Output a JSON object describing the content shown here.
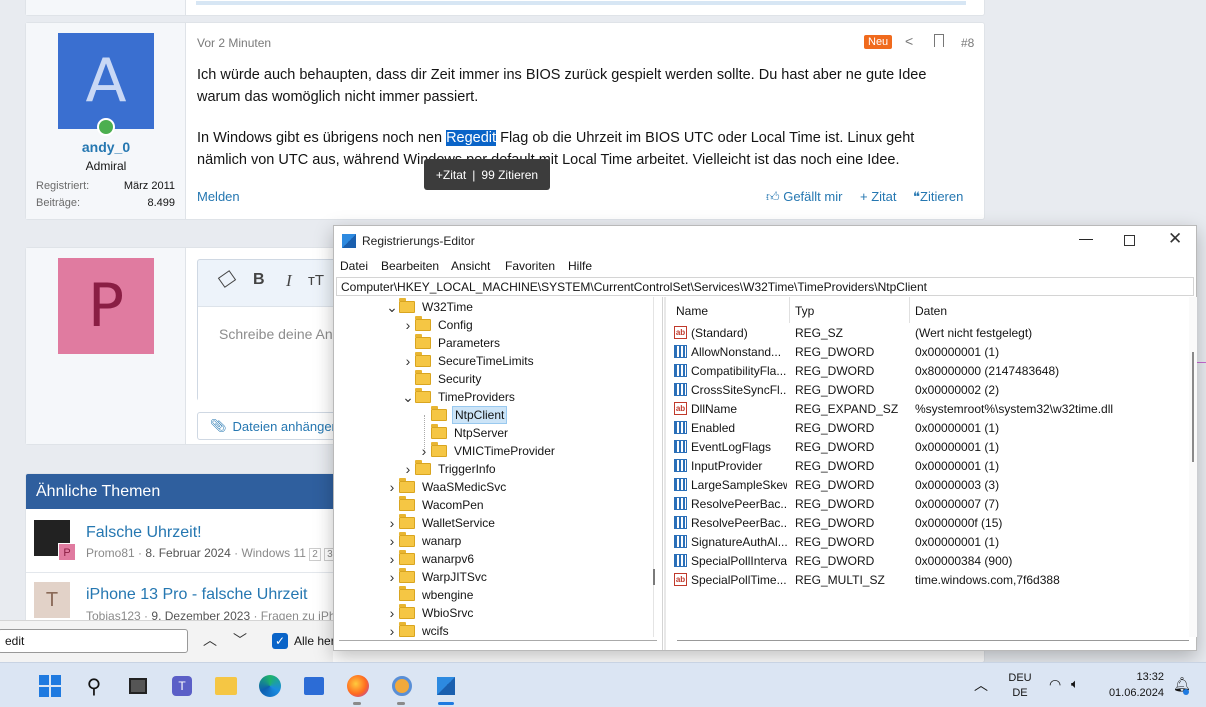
{
  "post": {
    "time": "Vor 2 Minuten",
    "new_badge": "Neu",
    "number": "#8",
    "author": {
      "avatar_letter": "A",
      "name": "andy_0",
      "role": "Admiral",
      "registered_label": "Registriert:",
      "registered_value": "März 2011",
      "posts_label": "Beiträge:",
      "posts_value": "8.499"
    },
    "para1": "Ich würde auch behaupten, dass dir Zeit immer ins BIOS zurück gespielt werden sollte. Du hast aber ne gute Idee warum das womöglich nicht immer passiert.",
    "para2_before": "In Windows gibt es übrigens noch nen ",
    "para2_highlight": "Regedit",
    "para2_after": " Flag ob die Uhrzeit im BIOS UTC oder Local Time ist. Linux geht nämlich von UTC aus, während Windows per default mit Local Time arbeitet. Vielleicht ist das noch eine Idee.",
    "tooltip_quote": "+Zitat",
    "tooltip_sep": "|",
    "tooltip_cite": "99 Zitieren",
    "report": "Melden",
    "like": "Gefällt mir",
    "quote": "+ Zitat",
    "cite": "Zitieren"
  },
  "reply": {
    "avatar_letter": "P",
    "placeholder": "Schreibe deine An",
    "attach": "Dateien anhängen",
    "toolbar": {
      "bold": "B",
      "italic": "I",
      "size": "тT"
    }
  },
  "similar": {
    "title": "Ähnliche Themen",
    "items": [
      {
        "title": "Falsche Uhrzeit!",
        "meta_user": "Promo81",
        "meta_date": "8. Februar 2024",
        "meta_forum": "Windows 11",
        "pages": [
          "2",
          "3"
        ],
        "badge": "P"
      },
      {
        "title": "iPhone 13 Pro - falsche Uhrzeit",
        "meta_user": "Tobias123",
        "meta_date": "9. Dezember 2023",
        "meta_forum": "Fragen zu iPhon",
        "avatar_letter": "T"
      }
    ]
  },
  "findbar": {
    "value": "edit",
    "checkbox_label": "Alle her"
  },
  "regedit": {
    "title": "Registrierungs-Editor",
    "menu": [
      "Datei",
      "Bearbeiten",
      "Ansicht",
      "Favoriten",
      "Hilfe"
    ],
    "address": "Computer\\HKEY_LOCAL_MACHINE\\SYSTEM\\CurrentControlSet\\Services\\W32Time\\TimeProviders\\NtpClient",
    "tree": [
      {
        "label": "W32Time",
        "level": 0,
        "exp": "v"
      },
      {
        "label": "Config",
        "level": 1,
        "exp": ">"
      },
      {
        "label": "Parameters",
        "level": 1,
        "exp": ""
      },
      {
        "label": "SecureTimeLimits",
        "level": 1,
        "exp": ">"
      },
      {
        "label": "Security",
        "level": 1,
        "exp": ""
      },
      {
        "label": "TimeProviders",
        "level": 1,
        "exp": "v"
      },
      {
        "label": "NtpClient",
        "level": 2,
        "exp": "",
        "selected": true
      },
      {
        "label": "NtpServer",
        "level": 2,
        "exp": ""
      },
      {
        "label": "VMICTimeProvider",
        "level": 2,
        "exp": ">"
      },
      {
        "label": "TriggerInfo",
        "level": 1,
        "exp": ">"
      },
      {
        "label": "WaaSMedicSvc",
        "level": 0,
        "exp": ">"
      },
      {
        "label": "WacomPen",
        "level": 0,
        "exp": ""
      },
      {
        "label": "WalletService",
        "level": 0,
        "exp": ">"
      },
      {
        "label": "wanarp",
        "level": 0,
        "exp": ">"
      },
      {
        "label": "wanarpv6",
        "level": 0,
        "exp": ">"
      },
      {
        "label": "WarpJITSvc",
        "level": 0,
        "exp": ">"
      },
      {
        "label": "wbengine",
        "level": 0,
        "exp": ""
      },
      {
        "label": "WbioSrvc",
        "level": 0,
        "exp": ">"
      },
      {
        "label": "wcifs",
        "level": 0,
        "exp": ">"
      }
    ],
    "columns": [
      "Name",
      "Typ",
      "Daten"
    ],
    "values": [
      {
        "name": "(Standard)",
        "type": "REG_SZ",
        "data": "(Wert nicht festgelegt)",
        "icon": "ab"
      },
      {
        "name": "AllowNonstand...",
        "type": "REG_DWORD",
        "data": "0x00000001 (1)",
        "icon": "bin"
      },
      {
        "name": "CompatibilityFla...",
        "type": "REG_DWORD",
        "data": "0x80000000 (2147483648)",
        "icon": "bin"
      },
      {
        "name": "CrossSiteSyncFl...",
        "type": "REG_DWORD",
        "data": "0x00000002 (2)",
        "icon": "bin"
      },
      {
        "name": "DllName",
        "type": "REG_EXPAND_SZ",
        "data": "%systemroot%\\system32\\w32time.dll",
        "icon": "ab"
      },
      {
        "name": "Enabled",
        "type": "REG_DWORD",
        "data": "0x00000001 (1)",
        "icon": "bin"
      },
      {
        "name": "EventLogFlags",
        "type": "REG_DWORD",
        "data": "0x00000001 (1)",
        "icon": "bin"
      },
      {
        "name": "InputProvider",
        "type": "REG_DWORD",
        "data": "0x00000001 (1)",
        "icon": "bin"
      },
      {
        "name": "LargeSampleSkew",
        "type": "REG_DWORD",
        "data": "0x00000003 (3)",
        "icon": "bin"
      },
      {
        "name": "ResolvePeerBac...",
        "type": "REG_DWORD",
        "data": "0x00000007 (7)",
        "icon": "bin"
      },
      {
        "name": "ResolvePeerBac...",
        "type": "REG_DWORD",
        "data": "0x0000000f (15)",
        "icon": "bin"
      },
      {
        "name": "SignatureAuthAl...",
        "type": "REG_DWORD",
        "data": "0x00000001 (1)",
        "icon": "bin"
      },
      {
        "name": "SpecialPollInterval",
        "type": "REG_DWORD",
        "data": "0x00000384 (900)",
        "icon": "bin"
      },
      {
        "name": "SpecialPollTime...",
        "type": "REG_MULTI_SZ",
        "data": "time.windows.com,7f6d388",
        "icon": "ab"
      }
    ]
  },
  "taskbar": {
    "lang_top": "DEU",
    "lang_bottom": "DE",
    "time": "13:32",
    "date": "01.06.2024"
  },
  "colors": {
    "accent": "#2577b1",
    "avatar_a": "#3a6fd0",
    "avatar_p": "#e07ba0",
    "new_badge": "#f06a1d",
    "header": "#2f5f9e"
  }
}
